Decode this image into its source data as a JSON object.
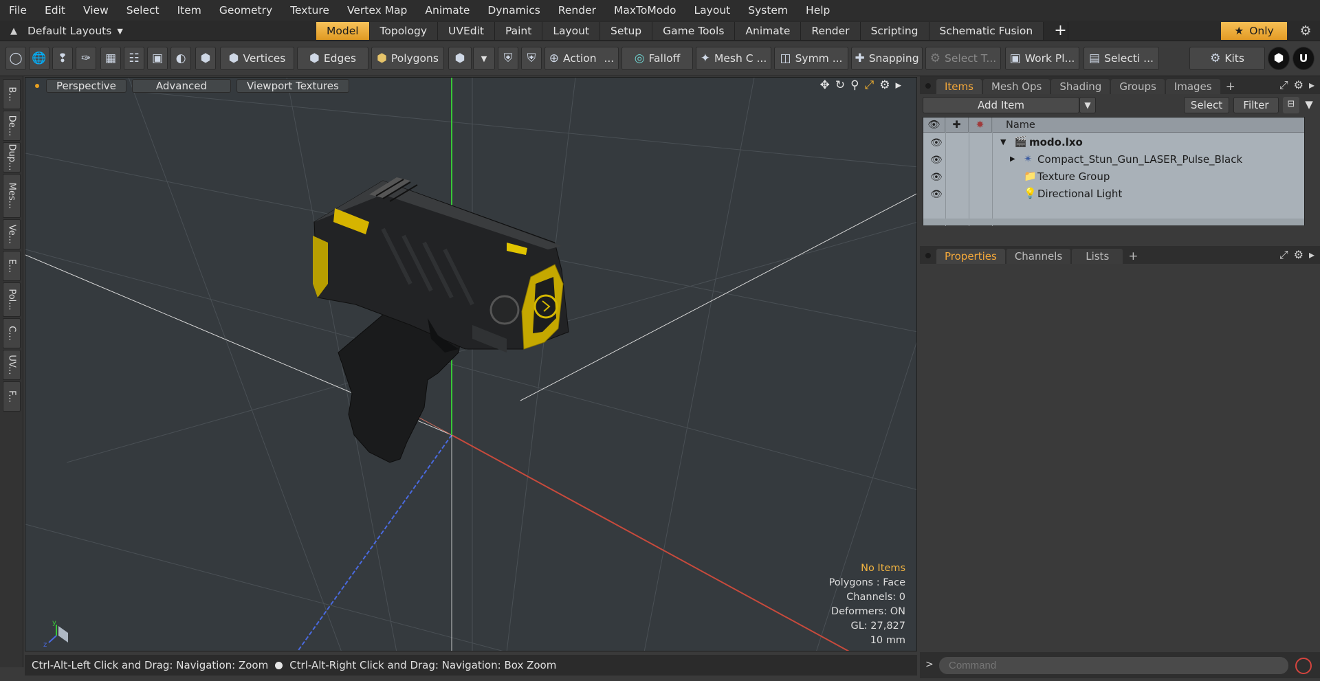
{
  "menu": [
    "File",
    "Edit",
    "View",
    "Select",
    "Item",
    "Geometry",
    "Texture",
    "Vertex Map",
    "Animate",
    "Dynamics",
    "Render",
    "MaxToModo",
    "Layout",
    "System",
    "Help"
  ],
  "layout_dropdown": "Default Layouts",
  "tabs": [
    "Model",
    "Topology",
    "UVEdit",
    "Paint",
    "Layout",
    "Setup",
    "Game Tools",
    "Animate",
    "Render",
    "Scripting",
    "Schematic Fusion"
  ],
  "only_label": "Only",
  "toolbar": {
    "vertices": "Vertices",
    "edges": "Edges",
    "polygons": "Polygons",
    "action": "Action",
    "falloff": "Falloff",
    "mesh": "Mesh C ...",
    "symmetry": "Symm ...",
    "snapping": "Snapping",
    "select_t": "Select T...",
    "work_plane": "Work Pl...",
    "selection": "Selecti ...",
    "kits": "Kits"
  },
  "left_tabs": [
    "B...",
    "De...",
    "Dup...",
    "Mes...",
    "Ve...",
    "E...",
    "Pol...",
    "C...",
    "UV...",
    "F..."
  ],
  "viewport": {
    "view": "Perspective",
    "shading": "Advanced",
    "textures": "Viewport Textures",
    "info": {
      "no_items": "No Items",
      "polygons": "Polygons : Face",
      "channels": "Channels: 0",
      "deformers": "Deformers: ON",
      "gl": "GL: 27,827",
      "scale": "10 mm"
    }
  },
  "status": {
    "left": "Ctrl-Alt-Left Click and Drag: Navigation: Zoom",
    "right": "Ctrl-Alt-Right Click and Drag: Navigation: Box Zoom"
  },
  "items_panel": {
    "tabs": [
      "Items",
      "Mesh Ops",
      "Shading",
      "Groups",
      "Images"
    ],
    "add_item": "Add Item",
    "select": "Select",
    "filter": "Filter",
    "name_header": "Name",
    "rows": [
      {
        "label": "modo.lxo",
        "icon": "scene-icon"
      },
      {
        "label": "Compact_Stun_Gun_LASER_Pulse_Black",
        "icon": "mesh-icon"
      },
      {
        "label": "Texture Group",
        "icon": "texture-group-icon"
      },
      {
        "label": "Directional Light",
        "icon": "light-icon"
      }
    ]
  },
  "properties_panel": {
    "tabs": [
      "Properties",
      "Channels",
      "Lists"
    ]
  },
  "command": {
    "placeholder": "Command"
  },
  "colors": {
    "accent": "#f0a830",
    "tree_bg": "#a9b1b8",
    "viewport_bg": "#353a3e"
  }
}
